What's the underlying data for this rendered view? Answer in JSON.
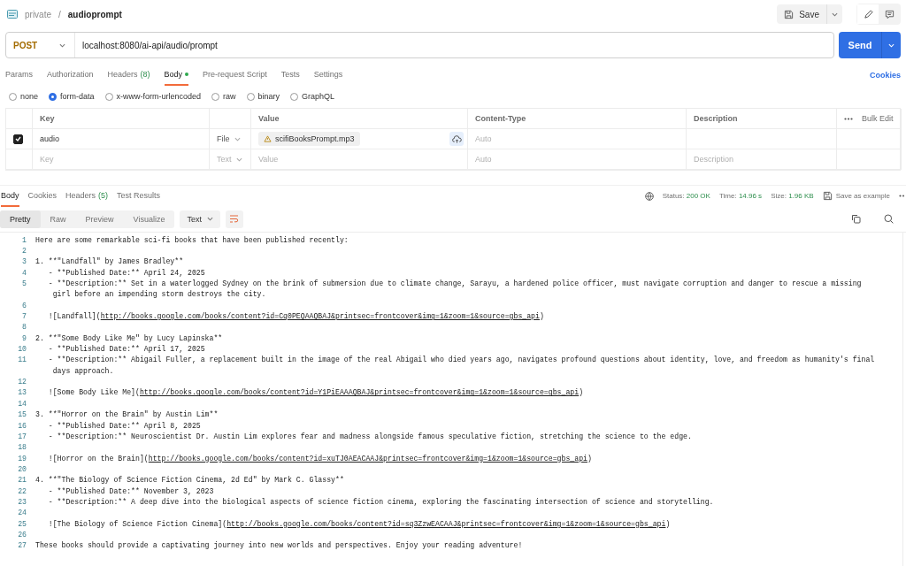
{
  "breadcrumb": {
    "workspace": "private",
    "separator": "/",
    "name": "audioprompt"
  },
  "toolbar": {
    "save": "Save"
  },
  "request": {
    "method": "POST",
    "url": "localhost:8080/ai-api/audio/prompt",
    "send": "Send"
  },
  "request_tabs": [
    {
      "label": "Params",
      "selected": false
    },
    {
      "label": "Authorization",
      "selected": false
    },
    {
      "label": "Headers",
      "count": "(8)",
      "selected": false
    },
    {
      "label": "Body",
      "dot": true,
      "selected": true
    },
    {
      "label": "Pre-request Script",
      "selected": false
    },
    {
      "label": "Tests",
      "selected": false
    },
    {
      "label": "Settings",
      "selected": false
    }
  ],
  "cookies_link": "Cookies",
  "body_types": [
    {
      "label": "none",
      "selected": false
    },
    {
      "label": "form-data",
      "selected": true
    },
    {
      "label": "x-www-form-urlencoded",
      "selected": false
    },
    {
      "label": "raw",
      "selected": false
    },
    {
      "label": "binary",
      "selected": false
    },
    {
      "label": "GraphQL",
      "selected": false
    }
  ],
  "form_table": {
    "columns": [
      "Key",
      "Value",
      "Content-Type",
      "Description"
    ],
    "bulk_edit": "Bulk Edit",
    "rows": [
      {
        "kind": "file",
        "checked": true,
        "key": "audio",
        "type": "File",
        "value": "scifiBooksPrompt.mp3",
        "content_type_placeholder": "Auto"
      },
      {
        "kind": "empty",
        "key_placeholder": "Key",
        "type": "Text",
        "value_placeholder": "Value",
        "content_type_placeholder": "Auto",
        "description_placeholder": "Description"
      }
    ]
  },
  "response_tabs": [
    {
      "label": "Body",
      "selected": true
    },
    {
      "label": "Cookies",
      "selected": false
    },
    {
      "label": "Headers",
      "count": "(5)",
      "selected": false
    },
    {
      "label": "Test Results",
      "selected": false
    }
  ],
  "status": [
    {
      "label": "Status:",
      "value": "200 OK"
    },
    {
      "label": "Time:",
      "value": "14.96 s"
    },
    {
      "label": "Size:",
      "value": "1.96 KB"
    }
  ],
  "save_example": "Save as example",
  "view_tabs": [
    {
      "label": "Pretty",
      "selected": true
    },
    {
      "label": "Raw",
      "selected": false
    },
    {
      "label": "Preview",
      "selected": false
    },
    {
      "label": "Visualize",
      "selected": false
    }
  ],
  "format": "Text",
  "code_lines": [
    {
      "number": "1",
      "text": "Here are some remarkable sci-fi books that have been published recently:"
    },
    {
      "number": "2"
    },
    {
      "number": "3",
      "text": "1. **\"Landfall\" by James Bradley**"
    },
    {
      "number": "4",
      "text": "   - **Published Date:** April 24, 2025"
    },
    {
      "number": "5",
      "text": "   - **Description:** Set in a waterlogged Sydney on the brink of submersion due to climate change, Sarayu, a hardened police officer, must navigate corruption and danger to rescue a missing",
      "wrap": "girl before an impending storm destroys the city."
    },
    {
      "number": "6"
    },
    {
      "number": "7",
      "text": "   ![Landfall](",
      "link": "http://books.google.com/books/content?id=Cq0PEQAAQBAJ&printsec=frontcover&img=1&zoom=1&source=gbs_api",
      "suffix": ")"
    },
    {
      "number": "8"
    },
    {
      "number": "9",
      "text": "2. **\"Some Body Like Me\" by Lucy Lapinska**"
    },
    {
      "number": "10",
      "text": "   - **Published Date:** April 17, 2025"
    },
    {
      "number": "11",
      "text": "   - **Description:** Abigail Fuller, a replacement built in the image of the real Abigail who died years ago, navigates profound questions about identity, love, and freedom as humanity's final",
      "wrap": "days approach."
    },
    {
      "number": "12"
    },
    {
      "number": "13",
      "text": "   ![Some Body Like Me](",
      "link": "http://books.google.com/books/content?id=Y1PiEAAAQBAJ&printsec=frontcover&img=1&zoom=1&source=gbs_api",
      "suffix": ")"
    },
    {
      "number": "14"
    },
    {
      "number": "15",
      "text": "3. **\"Horror on the Brain\" by Austin Lim**"
    },
    {
      "number": "16",
      "text": "   - **Published Date:** April 8, 2025"
    },
    {
      "number": "17",
      "text": "   - **Description:** Neuroscientist Dr. Austin Lim explores fear and madness alongside famous speculative fiction, stretching the science to the edge."
    },
    {
      "number": "18"
    },
    {
      "number": "19",
      "text": "   ![Horror on the Brain](",
      "link": "http://books.google.com/books/content?id=xuTJ0AEACAAJ&printsec=frontcover&img=1&zoom=1&source=gbs_api",
      "suffix": ")"
    },
    {
      "number": "20"
    },
    {
      "number": "21",
      "text": "4. **\"The Biology of Science Fiction Cinema, 2d Ed\" by Mark C. Glassy**"
    },
    {
      "number": "22",
      "text": "   - **Published Date:** November 3, 2023"
    },
    {
      "number": "23",
      "text": "   - **Description:** A deep dive into the biological aspects of science fiction cinema, exploring the fascinating intersection of science and storytelling."
    },
    {
      "number": "24"
    },
    {
      "number": "25",
      "text": "   ![The Biology of Science Fiction Cinema](",
      "link": "http://books.google.com/books/content?id=sq3ZzwEACAAJ&printsec=frontcover&img=1&zoom=1&source=gbs_api",
      "suffix": ")"
    },
    {
      "number": "26"
    },
    {
      "number": "27",
      "text": "These books should provide a captivating journey into new worlds and perspectives. Enjoy your reading adventure!"
    }
  ]
}
